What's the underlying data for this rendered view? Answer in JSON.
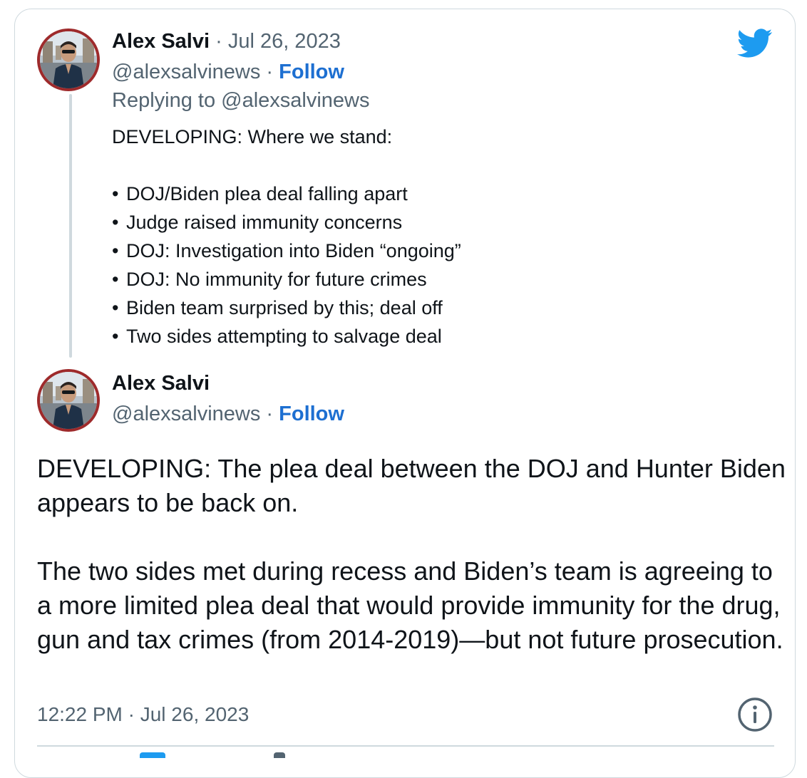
{
  "colors": {
    "brand": "#1d9bf0",
    "follow_link": "#1d6fd1",
    "muted_text": "#536471",
    "avatar_ring": "#9e2a2b"
  },
  "icons": {
    "brand_logo": "twitter-bird-icon",
    "info": "info-icon"
  },
  "parent_tweet": {
    "author_name": "Alex Salvi",
    "separator": " · ",
    "date": "Jul 26, 2023",
    "handle": "@alexsalvinews",
    "follow_label": "Follow",
    "replying_to": "Replying to @alexsalvinews",
    "headline": "DEVELOPING: Where we stand:",
    "bullets": [
      "DOJ/Biden plea deal falling apart",
      "Judge raised immunity concerns",
      "DOJ: Investigation into Biden “ongoing”",
      "DOJ: No immunity for future crimes",
      "Biden team surprised by this; deal off",
      "Two sides attempting to salvage deal"
    ],
    "bullet_glyph": "•"
  },
  "main_tweet": {
    "author_name": "Alex Salvi",
    "handle": "@alexsalvinews",
    "separator": " · ",
    "follow_label": "Follow",
    "paragraph_1": "DEVELOPING: The plea deal between the DOJ and Hunter Biden appears to be back on.",
    "paragraph_2": "The two sides met during recess and Biden’s team is agreeing to a more limited plea deal that would provide immunity for the drug, gun and tax crimes (from 2014-2019)—but not future prosecution.",
    "timestamp": "12:22 PM · Jul 26, 2023"
  }
}
